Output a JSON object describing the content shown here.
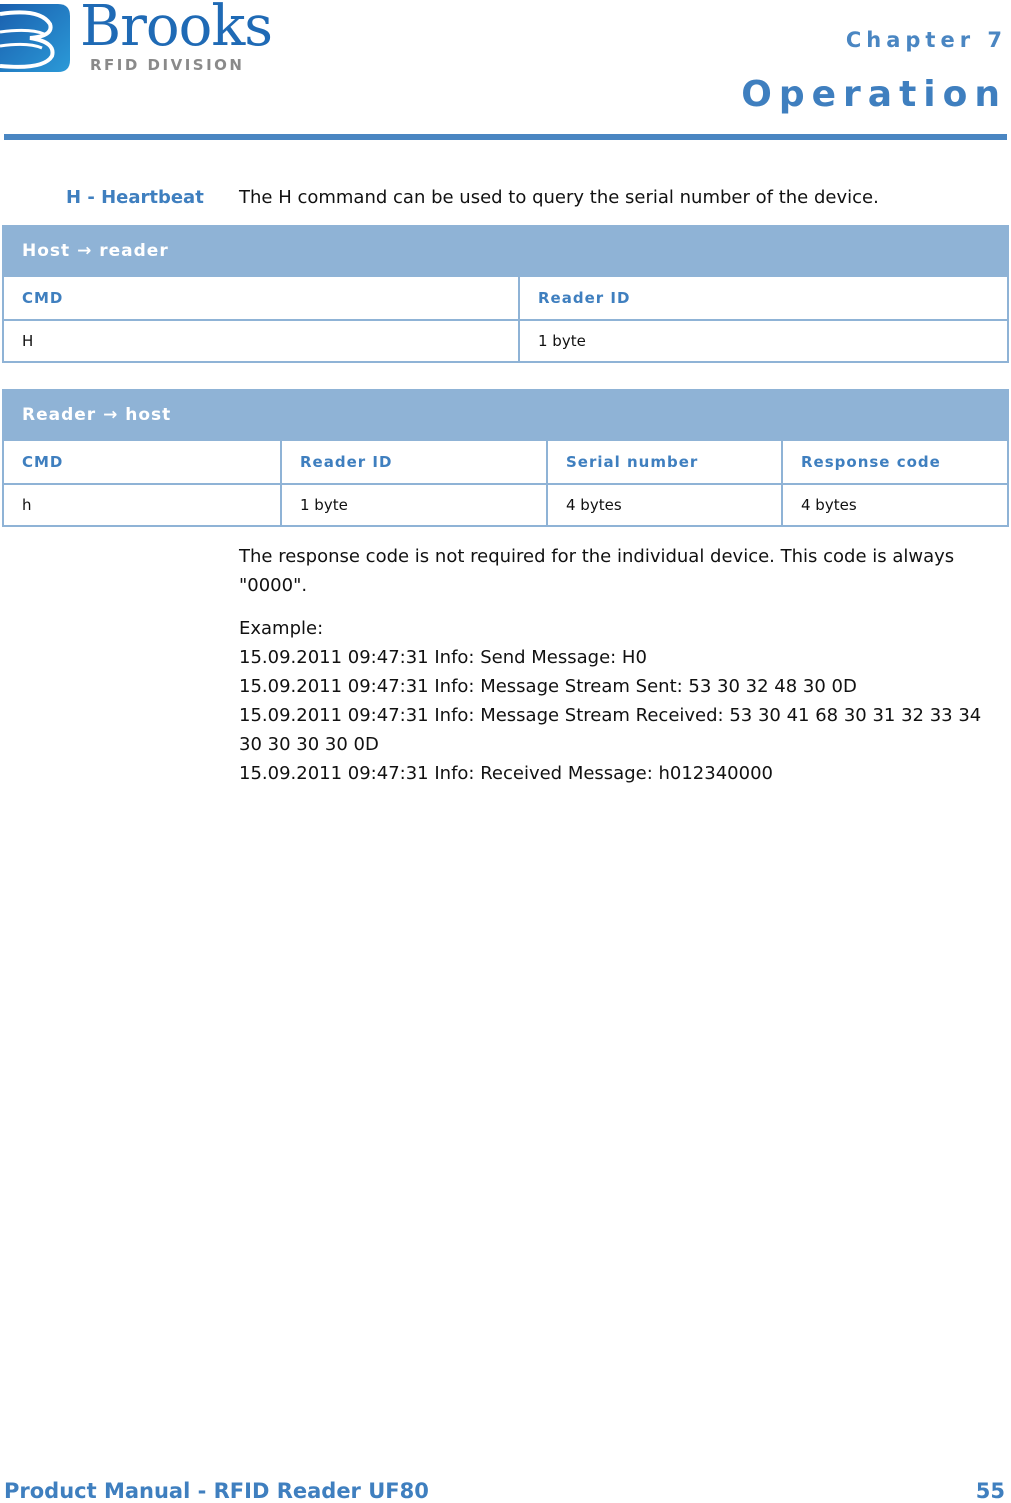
{
  "header": {
    "logo": {
      "name": "Brooks",
      "subtitle": "RFID DIVISION",
      "icon": "brooks-b-logo-icon"
    },
    "chapter": "Chapter 7",
    "section_title": "Operation"
  },
  "command": {
    "label": "H - Heartbeat",
    "description": "The H command can be used to query the serial number of the device."
  },
  "tables": [
    {
      "caption": "Host → reader",
      "columns": [
        "CMD",
        "Reader ID"
      ],
      "rows": [
        [
          "H",
          "1 byte"
        ]
      ]
    },
    {
      "caption": "Reader → host",
      "columns": [
        "CMD",
        "Reader ID",
        "Serial number",
        "Response code"
      ],
      "rows": [
        [
          "h",
          "1 byte",
          "4 bytes",
          "4 bytes"
        ]
      ]
    }
  ],
  "body": {
    "note": "The response code is not required for the individual device. This code is always \"0000\".",
    "example_label": "Example:",
    "log_lines": [
      "15.09.2011 09:47:31 Info: Send Message: H0",
      "15.09.2011 09:47:31 Info: Message Stream Sent: 53 30 32 48 30 0D",
      "15.09.2011 09:47:31 Info: Message Stream Received: 53 30 41 68 30 31 32 33 34 30 30 30 30 0D",
      "15.09.2011 09:47:31 Info: Received Message: h012340000"
    ]
  },
  "footer": {
    "title": "Product Manual - RFID Reader UF80",
    "page_number": "55"
  },
  "colors": {
    "accent": "#3f7fbf",
    "table_header_bg": "#8fb3d6",
    "logo_blue": "#1f6ab5",
    "logo_gray": "#8a8a8a"
  }
}
